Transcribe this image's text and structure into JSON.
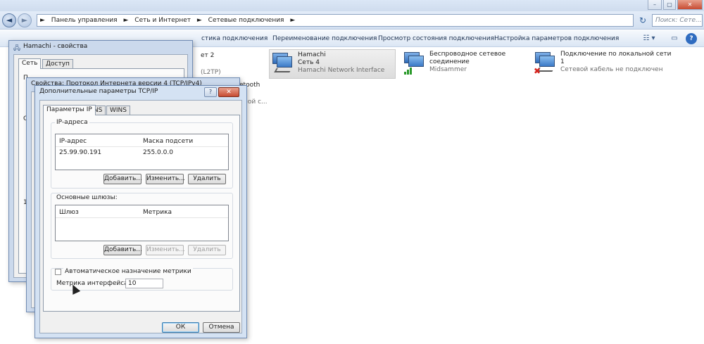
{
  "explorer": {
    "breadcrumbs": [
      "Панель управления",
      "►",
      "Сеть и Интернет",
      "►",
      "Сетевые подключения",
      "►"
    ],
    "search_placeholder": "Поиск: Сете...",
    "window_controls": [
      "–",
      "▢",
      "✕"
    ],
    "toolbar": [
      "стика подключения",
      "Переименование подключения",
      "Просмотр состояния подключения",
      "Настройка параметров подключения"
    ],
    "connections": [
      {
        "name": "Hamachi",
        "line2": "Сеть  4",
        "line3": "Hamachi Network Interface"
      },
      {
        "name": "Беспроводное сетевое",
        "line2": "соединение",
        "line3": "Midsammer"
      },
      {
        "name": "Подключение по локальной сети",
        "line2": "1",
        "line3": "Сетевой кабель не подключен"
      }
    ],
    "partial_texts": [
      "ет 2",
      "(L2TP)",
      "etooth",
      "ной с..."
    ]
  },
  "hamachi_dialog": {
    "title": "Hamachi - свойства",
    "tabs": [
      "Сеть",
      "Доступ"
    ],
    "fragments": [
      "П",
      "С",
      "1"
    ]
  },
  "ipv4_dialog": {
    "title": "Свойства: Протокол Интернета версии 4 (TCP/IPv4)"
  },
  "tcpip_dialog": {
    "title": "Дополнительные параметры TCP/IP",
    "help": "?",
    "close": "✕",
    "tabs": [
      "Параметры IP",
      "DNS",
      "WINS"
    ],
    "ip_group": {
      "label": "IP-адреса",
      "columns": [
        "IP-адрес",
        "Маска подсети"
      ],
      "rows": [
        {
          "ip": "25.99.90.191",
          "mask": "255.0.0.0"
        }
      ],
      "buttons": [
        "Добавить...",
        "Изменить...",
        "Удалить"
      ]
    },
    "gateway_group": {
      "label": "Основные шлюзы:",
      "columns": [
        "Шлюз",
        "Метрика"
      ],
      "buttons": [
        "Добавить...",
        "Изменить...",
        "Удалить"
      ]
    },
    "auto_metric": {
      "label": "Автоматическое назначение метрики",
      "checked": false
    },
    "interface_metric": {
      "label": "Метрика интерфейса:",
      "value": "10"
    },
    "ok": "ОК",
    "cancel": "Отмена"
  },
  "colors": {
    "accent": "#3c7fb1",
    "toolbar_bg": "#dbe6f4",
    "dialog_frame": "#cbd9ec",
    "close_red": "#c74b32"
  }
}
